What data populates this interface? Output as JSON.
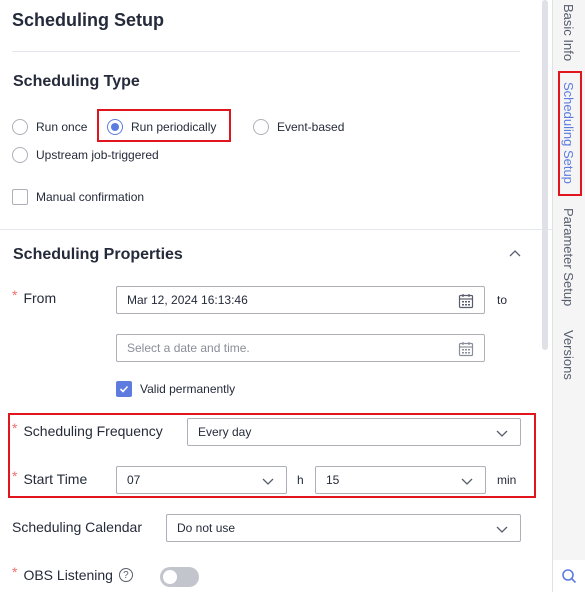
{
  "page": {
    "title": "Scheduling Setup"
  },
  "scheduling_type": {
    "title": "Scheduling Type",
    "options": [
      {
        "label": "Run once",
        "selected": false
      },
      {
        "label": "Run periodically",
        "selected": true
      },
      {
        "label": "Event-based",
        "selected": false
      },
      {
        "label": "Upstream job-triggered",
        "selected": false
      }
    ],
    "manual_confirmation": {
      "label": "Manual confirmation",
      "checked": false
    }
  },
  "properties": {
    "title": "Scheduling Properties",
    "from": {
      "label": "From",
      "start_value": "Mar 12, 2024 16:13:46",
      "to_label": "to",
      "end_placeholder": "Select a date and time."
    },
    "valid_permanently": {
      "label": "Valid permanently",
      "checked": true
    },
    "frequency": {
      "label": "Scheduling Frequency",
      "value": "Every day"
    },
    "start_time": {
      "label": "Start Time",
      "hour": "07",
      "hour_unit": "h",
      "minute": "15",
      "minute_unit": "min"
    },
    "calendar": {
      "label": "Scheduling Calendar",
      "value": "Do not use"
    },
    "obs_listening": {
      "label": "OBS Listening",
      "help": "?",
      "enabled": false
    }
  },
  "side_tabs": [
    {
      "label": "Basic Info",
      "active": false
    },
    {
      "label": "Scheduling Setup",
      "active": true
    },
    {
      "label": "Parameter Setup",
      "active": false
    },
    {
      "label": "Versions",
      "active": false
    }
  ],
  "colors": {
    "accent": "#5e7ce0",
    "highlight": "#e0151d",
    "required": "#f66f6a"
  },
  "icons": [
    "calendar-icon",
    "chevron-down-icon",
    "chevron-up-icon",
    "help-icon",
    "search-icon",
    "check-icon"
  ]
}
